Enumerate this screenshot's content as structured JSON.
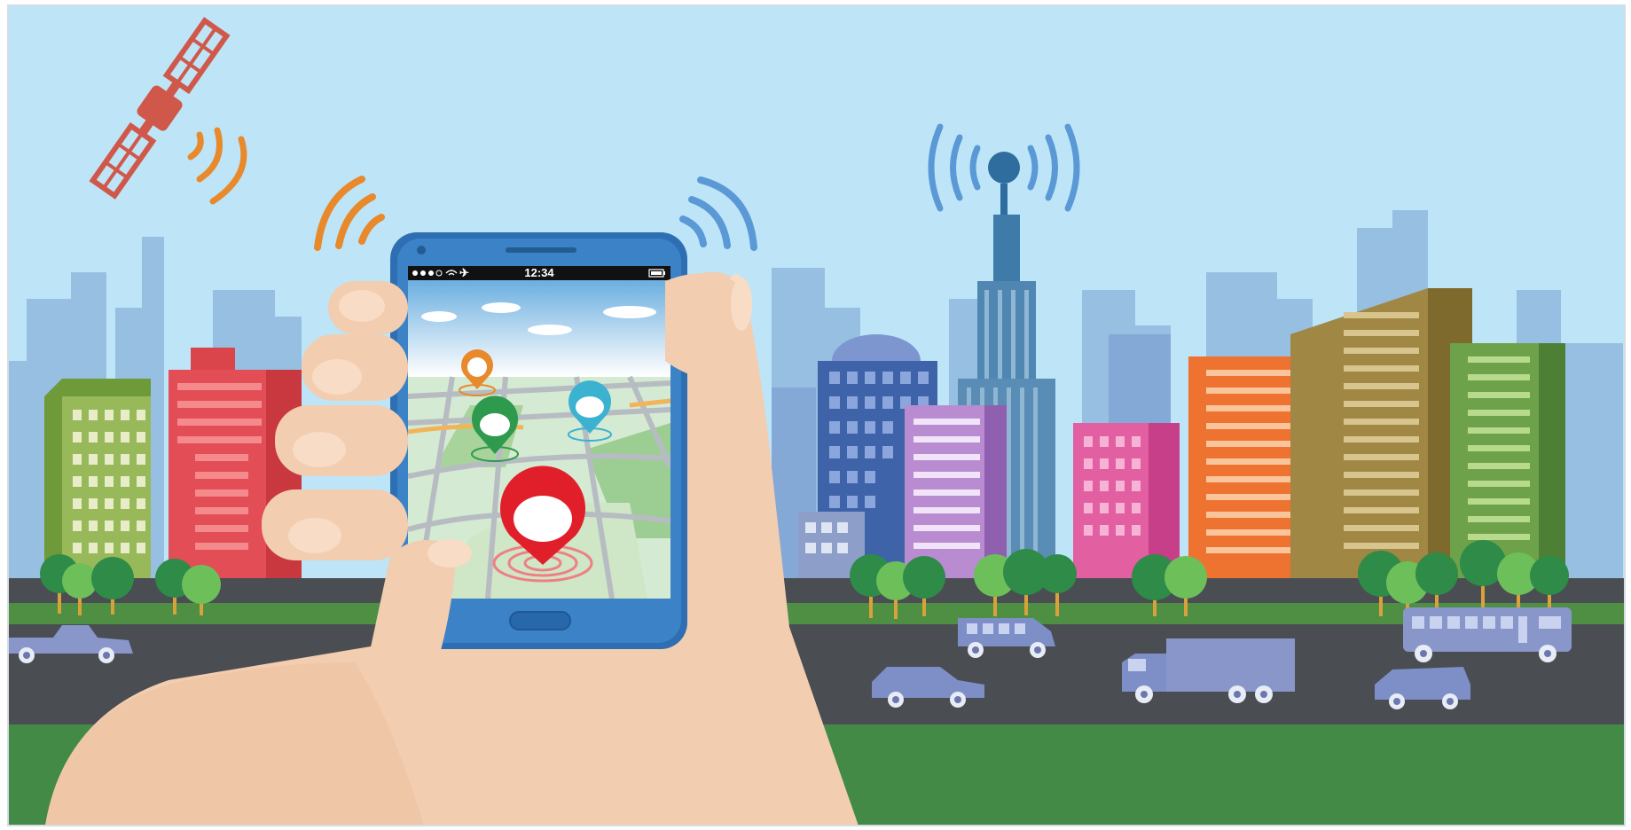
{
  "phone": {
    "status_time": "12:34"
  },
  "map_pins": [
    {
      "name": "orange",
      "color": "#e8892b"
    },
    {
      "name": "green",
      "color": "#2e9a4e"
    },
    {
      "name": "cyan",
      "color": "#3bb2d0"
    },
    {
      "name": "red",
      "color": "#e11f2a"
    }
  ],
  "palette": {
    "sky": "#bde5f7",
    "skyline_far": "#8fb8de",
    "road": "#4a4d52",
    "grass": "#438a46",
    "phone_body": "#2e6fb3",
    "skin": "#f2cdb0",
    "vehicle": "#7e8fc7",
    "signal_orange": "#e8892b",
    "signal_blue": "#5a98d6",
    "satellite": "#d0584a"
  }
}
